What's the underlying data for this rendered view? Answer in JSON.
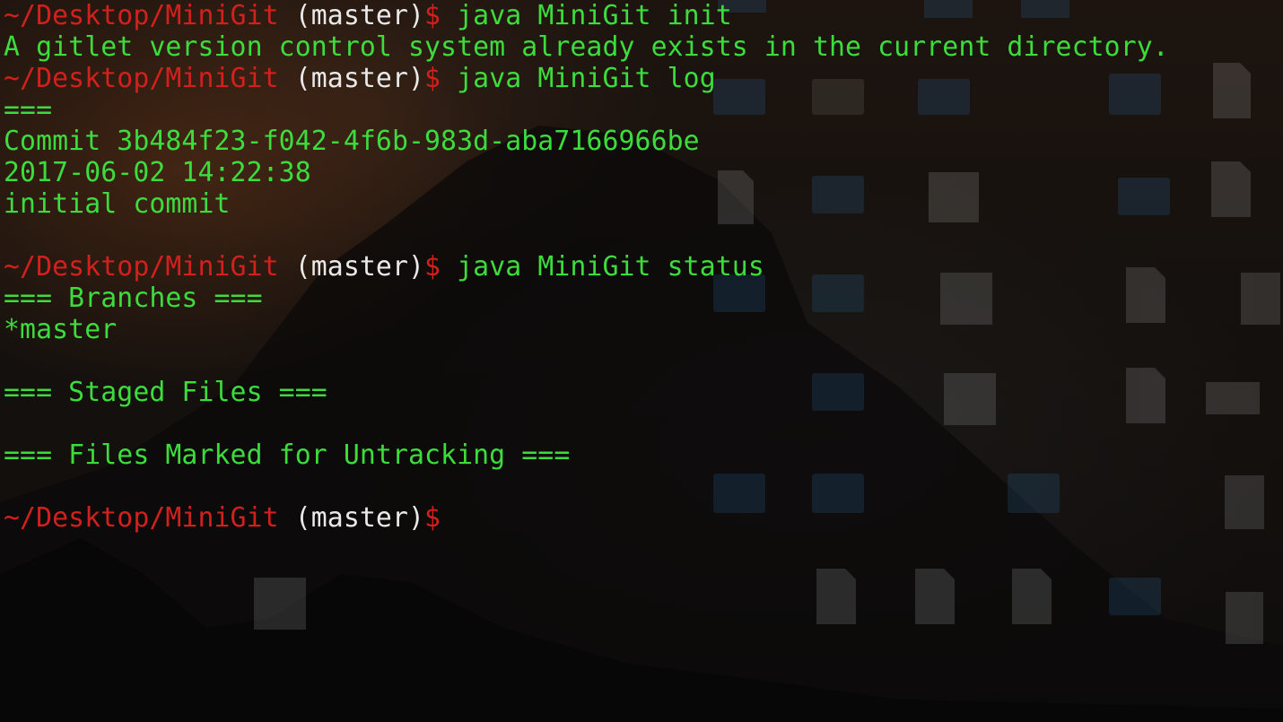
{
  "colors": {
    "prompt_path": "#d2201d",
    "prompt_branch": "#e9e9e9",
    "output_text": "#3ddc3d",
    "background": "#15110e"
  },
  "terminal": {
    "lines": [
      {
        "kind": "prompt",
        "path": "~/Desktop/MiniGit",
        "branch": " (master)",
        "dollar": "$",
        "command": " java MiniGit init"
      },
      {
        "kind": "output",
        "text": "A gitlet version control system already exists in the current directory."
      },
      {
        "kind": "prompt",
        "path": "~/Desktop/MiniGit",
        "branch": " (master)",
        "dollar": "$",
        "command": " java MiniGit log"
      },
      {
        "kind": "output",
        "text": "==="
      },
      {
        "kind": "output",
        "text": "Commit 3b484f23-f042-4f6b-983d-aba7166966be"
      },
      {
        "kind": "output",
        "text": "2017-06-02 14:22:38"
      },
      {
        "kind": "output",
        "text": "initial commit"
      },
      {
        "kind": "output",
        "text": ""
      },
      {
        "kind": "prompt",
        "path": "~/Desktop/MiniGit",
        "branch": " (master)",
        "dollar": "$",
        "command": " java MiniGit status"
      },
      {
        "kind": "output",
        "text": "=== Branches ==="
      },
      {
        "kind": "output",
        "text": "*master"
      },
      {
        "kind": "output",
        "text": ""
      },
      {
        "kind": "output",
        "text": "=== Staged Files ==="
      },
      {
        "kind": "output",
        "text": ""
      },
      {
        "kind": "output",
        "text": "=== Files Marked for Untracking ==="
      },
      {
        "kind": "output",
        "text": ""
      },
      {
        "kind": "prompt",
        "path": "~/Desktop/MiniGit",
        "branch": " (master)",
        "dollar": "$",
        "command": ""
      }
    ]
  }
}
